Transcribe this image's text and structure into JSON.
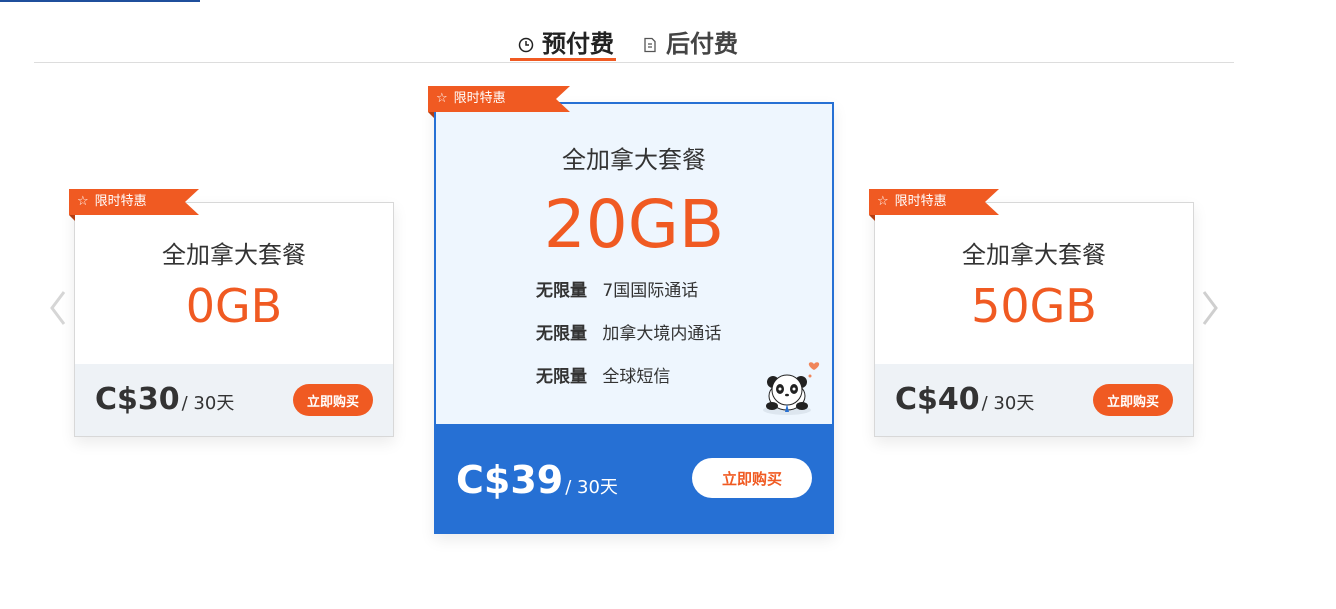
{
  "tabs": [
    {
      "label": "预付费",
      "icon": "clock-icon",
      "active": true
    },
    {
      "label": "后付费",
      "icon": "bill-icon",
      "active": false
    }
  ],
  "ribbon_label": "限时特惠",
  "plans": [
    {
      "name": "全加拿大套餐",
      "data": "0GB",
      "price": "C$30",
      "period": "/ 30天",
      "buy_label": "立即购买"
    },
    {
      "name": "全加拿大套餐",
      "data": "20GB",
      "features": [
        {
          "key": "无限量",
          "value": "7国国际通话"
        },
        {
          "key": "无限量",
          "value": "加拿大境内通话"
        },
        {
          "key": "无限量",
          "value": "全球短信"
        }
      ],
      "price": "C$39",
      "period": "/ 30天",
      "buy_label": "立即购买"
    },
    {
      "name": "全加拿大套餐",
      "data": "50GB",
      "price": "C$40",
      "period": "/ 30天",
      "buy_label": "立即购买"
    }
  ],
  "colors": {
    "accent": "#f05a22",
    "featured": "#2670d4",
    "featured_bg": "#eef6fe",
    "footer_bg": "#eef2f6"
  }
}
